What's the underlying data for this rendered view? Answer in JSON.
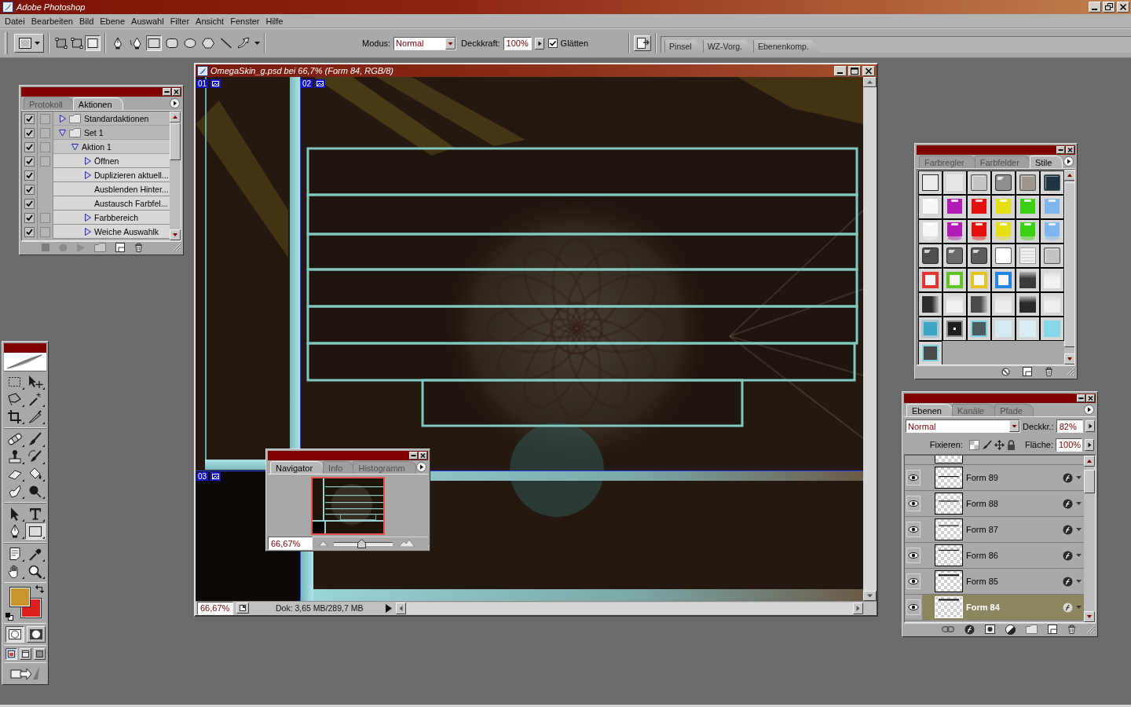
{
  "app": {
    "title": "Adobe Photoshop"
  },
  "menu": [
    "Datei",
    "Bearbeiten",
    "Bild",
    "Ebene",
    "Auswahl",
    "Filter",
    "Ansicht",
    "Fenster",
    "Hilfe"
  ],
  "options_bar": {
    "shape_modes": [
      {
        "kind": "shape-layer",
        "selected": false
      },
      {
        "kind": "path",
        "selected": false
      },
      {
        "kind": "fill-pixels",
        "selected": true
      }
    ],
    "shape_tools": [
      {
        "kind": "pen",
        "selected": false
      },
      {
        "kind": "freeform-pen",
        "selected": false
      },
      {
        "kind": "rectangle",
        "selected": true
      },
      {
        "kind": "rounded-rectangle",
        "selected": false
      },
      {
        "kind": "ellipse",
        "selected": false
      },
      {
        "kind": "polygon",
        "selected": false
      },
      {
        "kind": "line",
        "selected": false
      },
      {
        "kind": "custom-shape",
        "selected": false
      }
    ],
    "mode_label": "Modus:",
    "mode": "Normal",
    "opacity_label": "Deckkraft:",
    "opacity": "100%",
    "antialias": {
      "label": "Glätten",
      "checked": true
    },
    "palette_well": [
      "Pinsel",
      "WZ-Vorg.",
      "Ebenenkomp."
    ]
  },
  "actions_palette": {
    "tabs": [
      {
        "label": "Protokoll",
        "selected": false
      },
      {
        "label": "Aktionen",
        "selected": true
      }
    ],
    "items": [
      {
        "label": "Standardaktionen",
        "kind": "set",
        "checked": true,
        "dialog_on": false,
        "expanded": false
      },
      {
        "label": "Set 1",
        "kind": "set",
        "checked": true,
        "dialog_on": false,
        "expanded": true,
        "children": [
          {
            "label": "Aktion 1",
            "kind": "action",
            "checked": true,
            "dialog_on": false,
            "expanded": true,
            "children": [
              {
                "label": "Öffnen",
                "kind": "command",
                "checked": true,
                "dialog_on": false,
                "expanded": false
              },
              {
                "label": "Duplizieren aktuell...",
                "kind": "command",
                "checked": true,
                "expanded": false
              },
              {
                "label": "Ausblenden Hinter...",
                "kind": "command",
                "checked": true
              },
              {
                "label": "Austausch Farbfel...",
                "kind": "command",
                "checked": true
              },
              {
                "label": "Farbbereich",
                "kind": "command",
                "checked": true,
                "dialog_on": false,
                "expanded": false
              },
              {
                "label": "Weiche Auswahlk",
                "kind": "command",
                "checked": true,
                "dialog_on": false,
                "expanded": false
              }
            ]
          }
        ]
      }
    ]
  },
  "toolbox": {
    "groups": [
      {
        "tools": [
          {
            "kind": "marquee",
            "selected": false
          },
          {
            "kind": "move",
            "selected": false
          },
          {
            "kind": "lasso",
            "selected": false
          },
          {
            "kind": "magic-wand",
            "selected": false
          },
          {
            "kind": "crop",
            "selected": false
          },
          {
            "kind": "slice",
            "selected": false
          }
        ]
      },
      {
        "tools": [
          {
            "kind": "healing",
            "selected": false
          },
          {
            "kind": "brush",
            "selected": false
          },
          {
            "kind": "stamp",
            "selected": false
          },
          {
            "kind": "history-brush",
            "selected": false
          },
          {
            "kind": "eraser",
            "selected": false
          },
          {
            "kind": "bucket",
            "selected": false
          },
          {
            "kind": "smudge",
            "selected": false
          },
          {
            "kind": "burn",
            "selected": false
          }
        ]
      },
      {
        "tools": [
          {
            "kind": "path-select",
            "selected": false
          },
          {
            "kind": "type",
            "selected": false
          },
          {
            "kind": "pen",
            "selected": false
          },
          {
            "kind": "shape",
            "selected": true
          }
        ]
      },
      {
        "tools": [
          {
            "kind": "notes",
            "selected": false
          },
          {
            "kind": "eyedropper",
            "selected": false
          },
          {
            "kind": "hand",
            "selected": false
          },
          {
            "kind": "zoom",
            "selected": false
          }
        ]
      }
    ],
    "swatches": [
      {
        "kind": "foreground",
        "color": "#c8952a"
      },
      {
        "kind": "background",
        "color": "#dd1f1f"
      }
    ],
    "mask_modes": [
      {
        "kind": "standard",
        "selected": true
      },
      {
        "kind": "quick-mask",
        "selected": false
      }
    ],
    "screen_modes": [
      {
        "kind": "window",
        "selected": true
      },
      {
        "kind": "full-menu",
        "selected": false
      },
      {
        "kind": "full",
        "selected": false
      }
    ]
  },
  "document": {
    "title": "OmegaSkin_g.psd bei 66,7% (Form 84, RGB/8)",
    "slices": [
      "01",
      "02",
      "03"
    ],
    "zoom": "66,67%",
    "info": "Dok: 3,65 MB/289,7 MB"
  },
  "navigator": {
    "tabs": [
      {
        "label": "Navigator",
        "selected": true
      },
      {
        "label": "Info",
        "selected": false
      },
      {
        "label": "Histogramm",
        "selected": false
      }
    ],
    "zoom": "66,67%",
    "level": 0.47
  },
  "styles_palette": {
    "tabs": [
      {
        "label": "Farbregler",
        "selected": false
      },
      {
        "label": "Farbfelder",
        "selected": false
      },
      {
        "label": "Stile",
        "selected": true
      }
    ],
    "styles": [
      {
        "kind": "outline",
        "color": "#ececec"
      },
      {
        "kind": "flat",
        "color": "#e6e6e6"
      },
      {
        "kind": "bevel",
        "color": "#c4c4c4"
      },
      {
        "kind": "chrome",
        "color": "#8e8e8e"
      },
      {
        "kind": "bevel",
        "color": "#9c968e"
      },
      {
        "kind": "bevel",
        "color": "#1f3542"
      },
      {
        "kind": "glass",
        "color": "#f6f6f6"
      },
      {
        "kind": "glass",
        "color": "#b01cb4"
      },
      {
        "kind": "glass",
        "color": "#e41010"
      },
      {
        "kind": "glass",
        "color": "#e6e012"
      },
      {
        "kind": "glass",
        "color": "#3cd014"
      },
      {
        "kind": "glass",
        "color": "#7fb6f0"
      },
      {
        "kind": "glass-shadow",
        "color": "#f6f6f6"
      },
      {
        "kind": "glass-shadow",
        "color": "#b01cb4"
      },
      {
        "kind": "glass-shadow",
        "color": "#e41010"
      },
      {
        "kind": "glass-shadow",
        "color": "#e6e012"
      },
      {
        "kind": "glass-shadow",
        "color": "#3cd014"
      },
      {
        "kind": "glass-shadow",
        "color": "#7fb6f0"
      },
      {
        "kind": "chrome",
        "color": "#4e4e4e"
      },
      {
        "kind": "chrome",
        "color": "#6a6a6a"
      },
      {
        "kind": "chrome",
        "color": "#5c5c5c"
      },
      {
        "kind": "bevel",
        "color": "#ffffff"
      },
      {
        "kind": "lined",
        "color": "#f2f2f2"
      },
      {
        "kind": "bevel",
        "color": "#c2c2c2"
      },
      {
        "kind": "frame",
        "color": "#e43434"
      },
      {
        "kind": "frame",
        "color": "#62c424"
      },
      {
        "kind": "frame",
        "color": "#e2c424"
      },
      {
        "kind": "frame",
        "color": "#2684e2"
      },
      {
        "kind": "gradient",
        "color": "#3a3a3a"
      },
      {
        "kind": "gradient",
        "color": "#f2f2f2"
      },
      {
        "kind": "gradient-h",
        "color": "#2e2e2e"
      },
      {
        "kind": "gradient",
        "color": "#f0f0f0"
      },
      {
        "kind": "gradient-h",
        "color": "#4a4a4a"
      },
      {
        "kind": "gradient",
        "color": "#ececec"
      },
      {
        "kind": "gradient",
        "color": "#2a2a2a"
      },
      {
        "kind": "gradient",
        "color": "#eeeeee"
      },
      {
        "kind": "glow",
        "color": "#3ea6c4"
      },
      {
        "kind": "button",
        "color": "#1e1e1e"
      },
      {
        "kind": "glow-frame",
        "color": "#4e5a5c"
      },
      {
        "kind": "flat",
        "color": "#d4ecf0"
      },
      {
        "kind": "flat",
        "color": "#d8eef2"
      },
      {
        "kind": "flat",
        "color": "#86d8e8"
      },
      {
        "kind": "glow-frame",
        "color": "#4a4a4a"
      }
    ]
  },
  "layers_palette": {
    "tabs": [
      {
        "label": "Ebenen",
        "selected": true
      },
      {
        "label": "Kanäle",
        "selected": false
      },
      {
        "label": "Pfade",
        "selected": false
      }
    ],
    "blend_mode": "Normal",
    "opacity_label": "Deckkr.:",
    "opacity": "82%",
    "lock_label": "Fixieren:",
    "fill_label": "Fläche:",
    "fill": "100%",
    "layers": [
      {
        "name": "Form 89",
        "visible": true,
        "selected": false,
        "effects": true
      },
      {
        "name": "Form 88",
        "visible": true,
        "selected": false,
        "effects": true
      },
      {
        "name": "Form 87",
        "visible": true,
        "selected": false,
        "effects": true
      },
      {
        "name": "Form 86",
        "visible": true,
        "selected": false,
        "effects": true
      },
      {
        "name": "Form 85",
        "visible": true,
        "selected": false,
        "effects": true
      },
      {
        "name": "Form 84",
        "visible": true,
        "selected": true,
        "effects": true
      }
    ]
  }
}
